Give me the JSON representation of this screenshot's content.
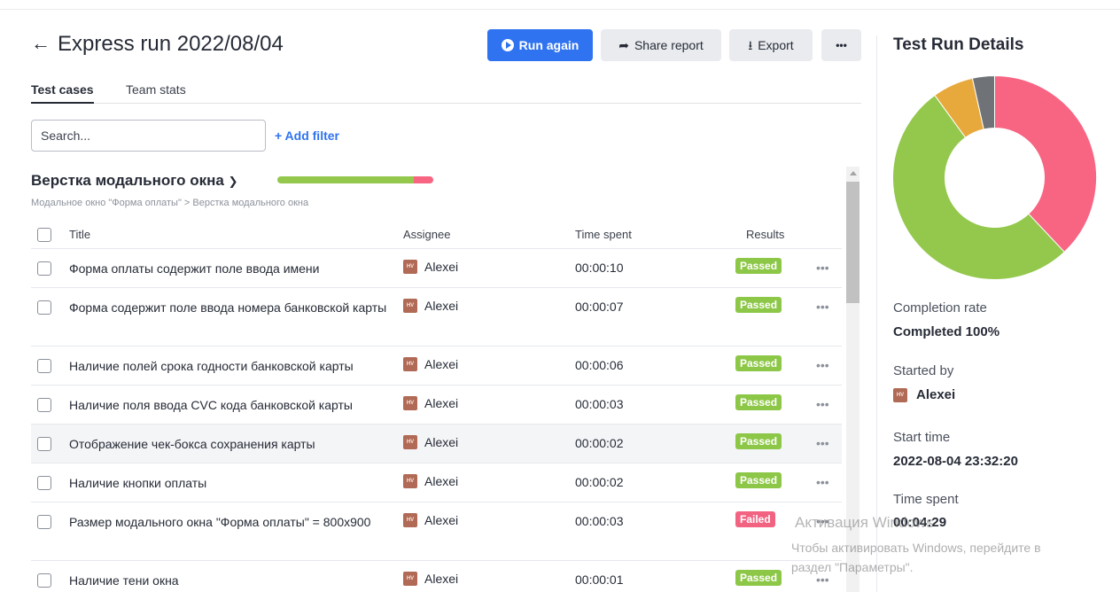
{
  "header": {
    "back_icon": "arrow-left-icon",
    "title": "Express run 2022/08/04",
    "run_again_label": "Run again",
    "share_label": "Share report",
    "export_label": "Export",
    "more_label": "•••"
  },
  "tabs": [
    {
      "label": "Test cases",
      "active": true
    },
    {
      "label": "Team stats",
      "active": false
    }
  ],
  "search": {
    "placeholder": "Search...",
    "value": ""
  },
  "add_filter_label": "+ Add filter",
  "suite": {
    "title": "Верстка модального окна",
    "breadcrumb": "Модальное окно \"Форма оплаты\" > Верстка модального окна",
    "progress_passed_fraction": 0.875,
    "progress_failed_fraction": 0.125
  },
  "table": {
    "columns": {
      "title": "Title",
      "assignee": "Assignee",
      "time": "Time spent",
      "results": "Results"
    },
    "rows": [
      {
        "title": "Форма оплаты содержит поле ввода имени",
        "assignee": "Alexei",
        "avatar": "HV",
        "time": "00:00:10",
        "result": "Passed"
      },
      {
        "title": "Форма содержит поле ввода номера банковской карты",
        "assignee": "Alexei",
        "avatar": "HV",
        "time": "00:00:07",
        "result": "Passed"
      },
      {
        "title": "Наличие полей срока годности банковской карты",
        "assignee": "Alexei",
        "avatar": "HV",
        "time": "00:00:06",
        "result": "Passed"
      },
      {
        "title": "Наличие поля ввода CVC кода банковской карты",
        "assignee": "Alexei",
        "avatar": "HV",
        "time": "00:00:03",
        "result": "Passed"
      },
      {
        "title": "Отображение чек-бокса сохранения карты",
        "assignee": "Alexei",
        "avatar": "HV",
        "time": "00:00:02",
        "result": "Passed"
      },
      {
        "title": "Наличие кнопки оплаты",
        "assignee": "Alexei",
        "avatar": "HV",
        "time": "00:00:02",
        "result": "Passed"
      },
      {
        "title": "Размер модального окна \"Форма оплаты\" = 800x900",
        "assignee": "Alexei",
        "avatar": "HV",
        "time": "00:00:03",
        "result": "Failed"
      },
      {
        "title": "Наличие тени окна",
        "assignee": "Alexei",
        "avatar": "HV",
        "time": "00:00:01",
        "result": "Passed"
      }
    ],
    "more_label": "•••"
  },
  "details": {
    "title": "Test Run Details",
    "completion_label": "Completion rate",
    "completion_value": "Completed 100%",
    "started_by_label": "Started by",
    "started_by_value": "Alexei",
    "started_by_avatar": "HV",
    "start_time_label": "Start time",
    "start_time_value": "2022-08-04 23:32:20",
    "time_spent_label": "Time spent",
    "time_spent_value": "00:04:29"
  },
  "donut": {
    "segments": [
      {
        "color": "#f76583",
        "fraction": 0.38
      },
      {
        "color": "#93c84c",
        "fraction": 0.52
      },
      {
        "color": "#e8a93c",
        "fraction": 0.065
      },
      {
        "color": "#6f7276",
        "fraction": 0.035
      }
    ]
  },
  "watermark": {
    "line1": "Активация Windows",
    "line2": "Чтобы активировать Windows, перейдите в",
    "line3": "раздел \"Параметры\"."
  },
  "colors": {
    "accent": "#2f73f0",
    "passed": "#8dc748",
    "failed": "#f26382"
  }
}
